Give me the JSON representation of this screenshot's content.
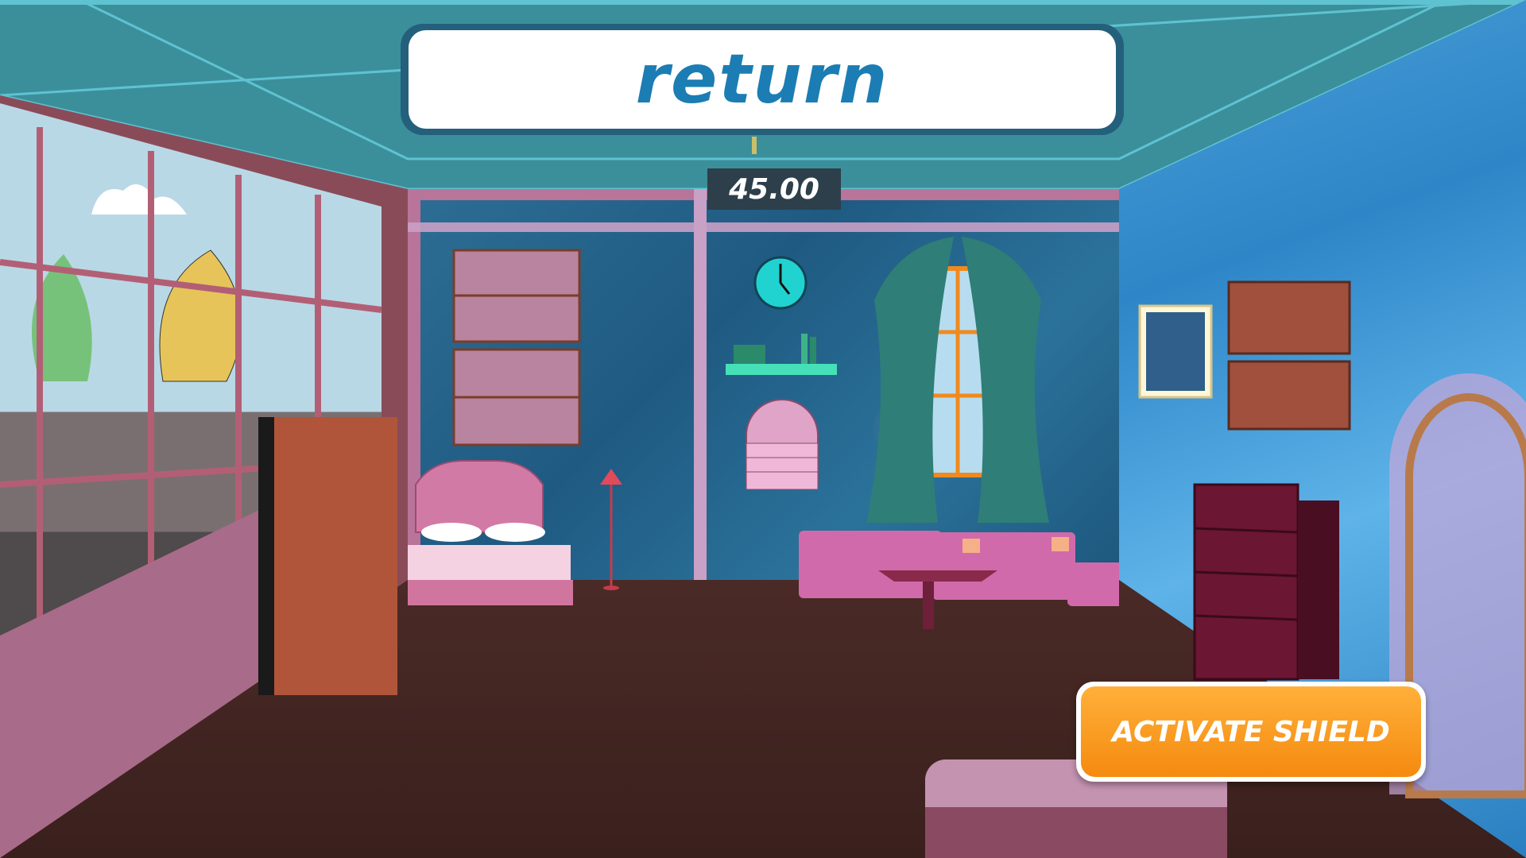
{
  "title": {
    "word": "return"
  },
  "timer": {
    "value": "45.00"
  },
  "shield_button": {
    "label": "ACTIVATE SHIELD"
  },
  "colors": {
    "accent": "#1b7db3",
    "button": "#f59a1a",
    "ceiling": "#3a8f9b"
  },
  "scene": {
    "icons": [
      "clock-icon",
      "bed",
      "sofa",
      "table",
      "cabinet",
      "dresser",
      "window",
      "painting",
      "floor-lamp",
      "shelf",
      "stool"
    ]
  }
}
